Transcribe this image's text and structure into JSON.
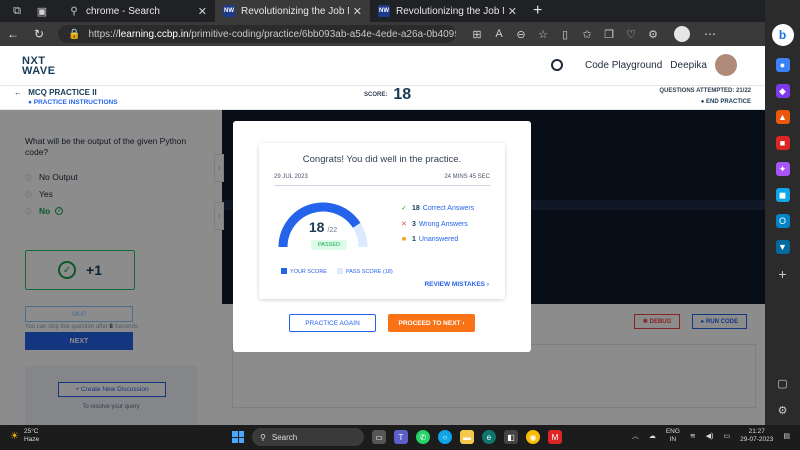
{
  "browser": {
    "tabs": [
      {
        "title": "chrome - Search",
        "favicon": "search-icon",
        "active": false
      },
      {
        "title": "Revolutionizing the Job Market |",
        "favicon": "ccbp-favicon",
        "active": true
      },
      {
        "title": "Revolutionizing the Job Market |",
        "favicon": "ccbp-favicon",
        "active": false
      }
    ],
    "url_prefix": "https://",
    "url_host": "learning.ccbp.in",
    "url_path": "/primitive-coding/practice/6bb093ab-a54e-4ede-a26a-0b4095d85..."
  },
  "header": {
    "logo_line1": "NXT",
    "logo_line2": "WAVE",
    "code_playground": "Code Playground",
    "user_name": "Deepika"
  },
  "subheader": {
    "title": "MCQ PRACTICE II",
    "instructions": "PRACTICE INSTRUCTIONS",
    "score_label": "SCORE:",
    "score_value": "18",
    "attempted": "QUESTIONS ATTEMPTED: 21/22",
    "end_practice": "END PRACTICE"
  },
  "question": {
    "text": "What will be the output of the given Python code?",
    "options": [
      "No Output",
      "Yes",
      "No"
    ],
    "correct_index": 2,
    "points": "+1",
    "skip": "SKIP",
    "skip_note_prefix": "You can skip this question after ",
    "skip_note_bold": "8",
    "skip_note_suffix": " Seconds",
    "next": "NEXT",
    "create_discussion": "+ Create New Discussion",
    "resolve": "To resolve your query"
  },
  "editor": {
    "debug": "DEBUG",
    "run_code": "RUN CODE"
  },
  "modal": {
    "congrats": "Congrats! You did well in the practice.",
    "date": "29 JUL 2023",
    "duration": "24 MINS 45 SEC",
    "score": "18",
    "total": "/22",
    "score_fraction": 0.818,
    "pass_fraction": 0.818,
    "status": "PASSED",
    "correct_count": "18",
    "correct_label": "Correct Answers",
    "wrong_count": "3",
    "wrong_label": "Wrong Answers",
    "unanswered_count": "1",
    "unanswered_label": "Unanswered",
    "legend_your": "YOUR SCORE",
    "legend_pass": "PASS SCORE (18)",
    "review": "REVIEW MISTAKES",
    "practice_again": "PRACTICE AGAIN",
    "proceed": "PROCEED TO NEXT",
    "colors": {
      "gauge": "#2563eb",
      "gauge_bg": "#dbeafe",
      "correct": "#16a34a",
      "wrong": "#ef4444",
      "unanswered": "#f59e0b",
      "proceed": "#f97316"
    }
  },
  "taskbar": {
    "temp": "25°C",
    "weather": "Haze",
    "search": "Search",
    "lang1": "ENG",
    "lang2": "IN",
    "time": "21:27",
    "date": "29-07-2023"
  }
}
